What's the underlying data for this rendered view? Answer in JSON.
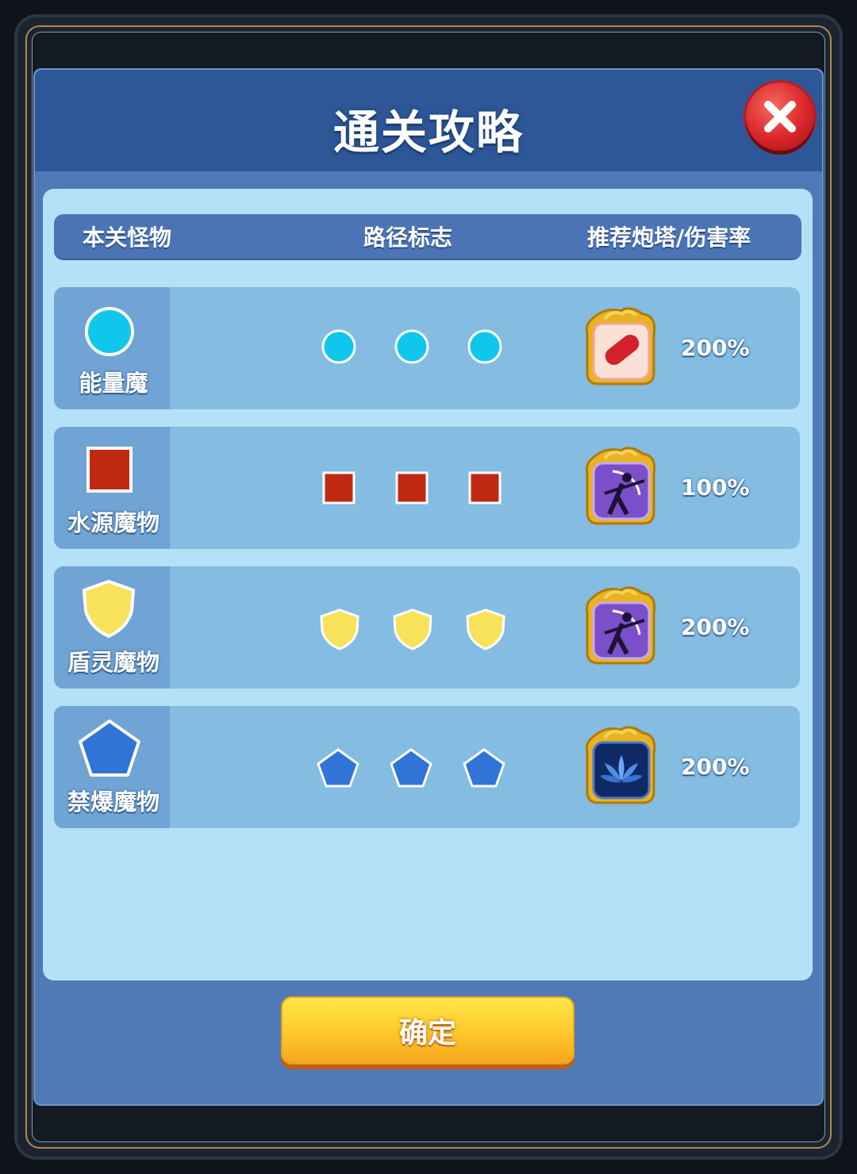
{
  "dialog": {
    "title": "通关攻略",
    "close_icon": "close-x-icon",
    "confirm_label": "确定"
  },
  "columns": {
    "monster": "本关怪物",
    "path": "路径标志",
    "tower": "推荐炮塔/伤害率"
  },
  "rows": [
    {
      "name": "能量魔",
      "shape": "circle",
      "color": "#0fc7ec",
      "marker_count": 3,
      "tower_icon": "red-capsule-tower-icon",
      "rate": "200%"
    },
    {
      "name": "水源魔物",
      "shape": "square",
      "color": "#c02a12",
      "marker_count": 3,
      "tower_icon": "purple-archer-tower-icon",
      "rate": "100%"
    },
    {
      "name": "盾灵魔物",
      "shape": "shield",
      "color": "#f7e25a",
      "marker_count": 3,
      "tower_icon": "purple-archer-tower-icon",
      "rate": "200%"
    },
    {
      "name": "禁爆魔物",
      "shape": "pentagon",
      "color": "#2f74d6",
      "marker_count": 3,
      "tower_icon": "blue-lotus-tower-icon",
      "rate": "200%"
    }
  ]
}
